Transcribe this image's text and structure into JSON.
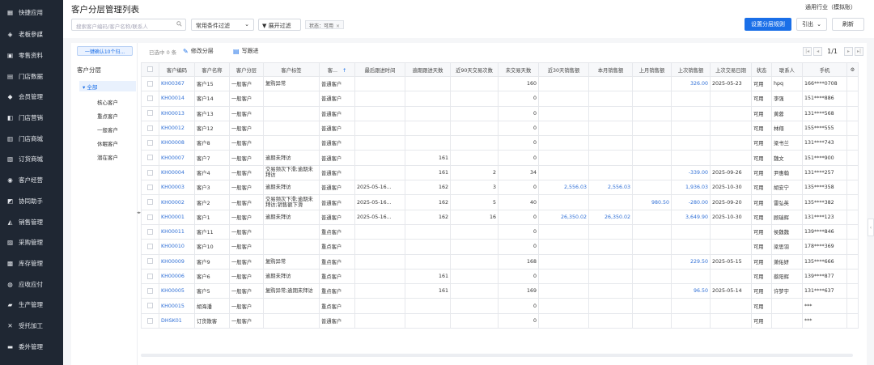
{
  "sidebar": {
    "items": [
      {
        "label": "快捷应用",
        "icon": "apps-icon"
      },
      {
        "label": "老板參謀",
        "icon": "layers-icon"
      },
      {
        "label": "零售资料",
        "icon": "box-icon"
      },
      {
        "label": "门店数据",
        "icon": "document-icon"
      },
      {
        "label": "会员管理",
        "icon": "diamond-icon"
      },
      {
        "label": "门店营销",
        "icon": "tag-icon"
      },
      {
        "label": "门店商城",
        "icon": "store-icon"
      },
      {
        "label": "订货商城",
        "icon": "cart-icon"
      },
      {
        "label": "客户经营",
        "icon": "user-icon"
      },
      {
        "label": "协同助手",
        "icon": "cube-icon"
      },
      {
        "label": "销售管理",
        "icon": "chart-icon"
      },
      {
        "label": "采购管理",
        "icon": "basket-icon"
      },
      {
        "label": "库存管理",
        "icon": "warehouse-icon"
      },
      {
        "label": "应收应付",
        "icon": "money-icon"
      },
      {
        "label": "生产管理",
        "icon": "factory-icon"
      },
      {
        "label": "受托加工",
        "icon": "tools-icon"
      },
      {
        "label": "委外管理",
        "icon": "folder-icon"
      }
    ]
  },
  "header": {
    "title": "客户分层管理列表",
    "industry": "通用行业（模拟账）",
    "search_placeholder": "搜索客户编码/客户名称/联系人",
    "filter_select": "常用条件过滤",
    "expand_filter": "展开过滤",
    "chip": "状态：可用",
    "set_rule": "设置分层规则",
    "import": "引出",
    "refresh": "刷新"
  },
  "left": {
    "confirm_button": "一键确认10个归...",
    "title": "客户分层",
    "root": "全部",
    "children": [
      "核心客户",
      "重点客户",
      "一般客户",
      "休眠客户",
      "潜在客户"
    ]
  },
  "toolbar": {
    "selected": "已选中 0 条",
    "edit": "修改分层",
    "follow": "写跟进",
    "page": "1/1"
  },
  "table": {
    "columns": [
      "客户编码",
      "客户名称",
      "客户分层",
      "客户标签",
      "客...",
      "最后跟进时间",
      "逾期跟进天数",
      "近90天交易次数",
      "未交易天数",
      "近30天销售额",
      "本月销售额",
      "上月销售额",
      "上次销售额",
      "上次交易日期",
      "状态",
      "联系人",
      "手机"
    ],
    "rows": [
      [
        "KH00367",
        "客户15",
        "一般客户",
        "复购异常",
        "普通客户",
        "",
        "",
        "",
        "160",
        "",
        "",
        "",
        "326.00",
        "2025-05-23",
        "可用",
        "hpq",
        "166****0708"
      ],
      [
        "KH00014",
        "客户14",
        "一般客户",
        "",
        "普通客户",
        "",
        "",
        "",
        "0",
        "",
        "",
        "",
        "",
        "",
        "可用",
        "李强",
        "151****886"
      ],
      [
        "KH00013",
        "客户13",
        "一般客户",
        "",
        "普通客户",
        "",
        "",
        "",
        "0",
        "",
        "",
        "",
        "",
        "",
        "可用",
        "黄蓉",
        "131****568"
      ],
      [
        "KH00012",
        "客户12",
        "一般客户",
        "",
        "普通客户",
        "",
        "",
        "",
        "0",
        "",
        "",
        "",
        "",
        "",
        "可用",
        "林翔",
        "155****555"
      ],
      [
        "KH00008",
        "客户8",
        "一般客户",
        "",
        "普通客户",
        "",
        "",
        "",
        "0",
        "",
        "",
        "",
        "",
        "",
        "可用",
        "梁书兰",
        "131****743"
      ],
      [
        "KH00007",
        "客户7",
        "一般客户",
        "逾期未拜访",
        "普通客户",
        "",
        "161",
        "",
        "0",
        "",
        "",
        "",
        "",
        "",
        "可用",
        "魏文",
        "151****900"
      ],
      [
        "KH00004",
        "客户4",
        "一般客户",
        "交易频次下滑;逾期未拜访",
        "普通客户",
        "",
        "161",
        "2",
        "34",
        "",
        "",
        "",
        "-339.00",
        "2025-09-26",
        "可用",
        "尹惠翰",
        "131****257"
      ],
      [
        "KH00003",
        "客户3",
        "一般客户",
        "逾期未拜访",
        "普通客户",
        "2025-05-16...",
        "162",
        "3",
        "0",
        "2,556.03",
        "2,556.03",
        "",
        "1,936.03",
        "2025-10-30",
        "可用",
        "胡安宁",
        "135****358"
      ],
      [
        "KH00002",
        "客户2",
        "一般客户",
        "交易频次下滑;逾期未拜访;销售额下滑",
        "普通客户",
        "2025-05-16...",
        "162",
        "5",
        "40",
        "",
        "",
        "980.50",
        "-280.00",
        "2025-09-20",
        "可用",
        "雷弘英",
        "135****382"
      ],
      [
        "KH00001",
        "客户1",
        "一般客户",
        "逾期未拜访",
        "普通客户",
        "2025-05-16...",
        "162",
        "16",
        "0",
        "26,350.02",
        "26,350.02",
        "",
        "3,649.90",
        "2025-10-30",
        "可用",
        "顾瑞辉",
        "131****123"
      ],
      [
        "KH00011",
        "客户11",
        "一般客户",
        "",
        "重点客户",
        "",
        "",
        "",
        "0",
        "",
        "",
        "",
        "",
        "",
        "可用",
        "侯魏魏",
        "139****846"
      ],
      [
        "KH00010",
        "客户10",
        "一般客户",
        "",
        "重点客户",
        "",
        "",
        "",
        "0",
        "",
        "",
        "",
        "",
        "",
        "可用",
        "梁思羽",
        "178****369"
      ],
      [
        "KH00009",
        "客户9",
        "一般客户",
        "复购异常",
        "重点客户",
        "",
        "",
        "",
        "168",
        "",
        "",
        "",
        "229.50",
        "2025-05-15",
        "可用",
        "萧佑妍",
        "135****666"
      ],
      [
        "KH00006",
        "客户6",
        "一般客户",
        "逾期未拜访",
        "重点客户",
        "",
        "161",
        "",
        "0",
        "",
        "",
        "",
        "",
        "",
        "可用",
        "蔡阳辉",
        "139****877"
      ],
      [
        "KH00005",
        "客户5",
        "一般客户",
        "复购异常;逾期未拜访",
        "重点客户",
        "",
        "161",
        "",
        "169",
        "",
        "",
        "",
        "96.50",
        "2025-05-14",
        "可用",
        "许梦宇",
        "131****637"
      ],
      [
        "KH00015",
        "胡海潘",
        "一般客户",
        "",
        "重点客户",
        "",
        "",
        "",
        "0",
        "",
        "",
        "",
        "",
        "",
        "可用",
        "",
        "***"
      ],
      [
        "DHSK01",
        "订货散客",
        "一般客户",
        "",
        "普通客户",
        "",
        "",
        "",
        "0",
        "",
        "",
        "",
        "",
        "",
        "可用",
        "",
        "***"
      ]
    ]
  },
  "colors": {
    "accent": "#1a6fe8",
    "sidebar": "#1f2733",
    "link": "#2f6fd6"
  }
}
